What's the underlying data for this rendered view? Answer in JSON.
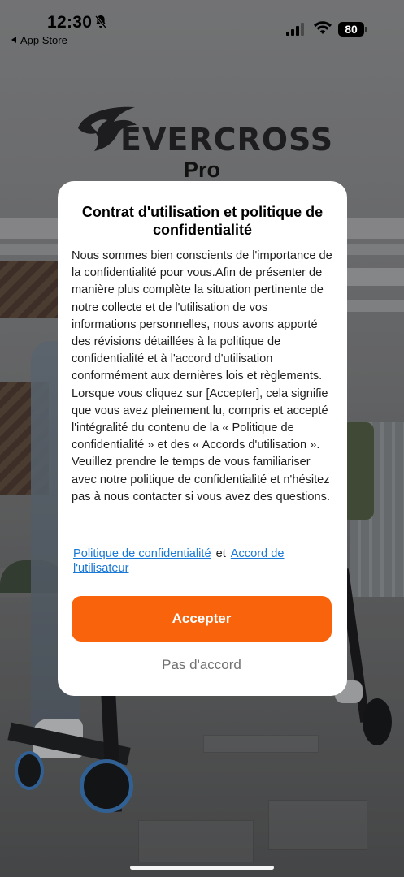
{
  "status_bar": {
    "time": "12:30",
    "back_app": "App Store",
    "battery": "80",
    "icons": [
      "bell-slash-icon",
      "signal-icon",
      "wifi-icon",
      "battery-icon"
    ]
  },
  "logo": {
    "brand": "EVERCROSS",
    "sub": "Pro"
  },
  "dialog": {
    "title": "Contrat d'utilisation et politique de confidentialité",
    "body": "Nous sommes bien conscients de l'importance de la confidentialité pour vous.Afin de présenter de manière plus complète la situation pertinente de notre collecte et de l'utilisation de vos informations personnelles, nous avons apporté des révisions détaillées à la politique de confidentialité et à l'accord d'utilisation conformément aux dernières lois et règlements. Lorsque vous cliquez sur [Accepter], cela signifie que vous avez pleinement lu, compris et accepté l'intégralité du contenu de la « Politique de confidentialité » et des « Accords d'utilisation ». Veuillez prendre le temps de vous familiariser avec notre politique de confidentialité et n'hésitez pas à nous contacter si vous avez des questions.",
    "privacy_link": "Politique de confidentialité",
    "and_text": "et",
    "user_agreement_link": "Accord de l'utilisateur",
    "accept_label": "Accepter",
    "decline_label": "Pas d'accord"
  },
  "colors": {
    "accent": "#f9630c",
    "link": "#1a78d6"
  }
}
